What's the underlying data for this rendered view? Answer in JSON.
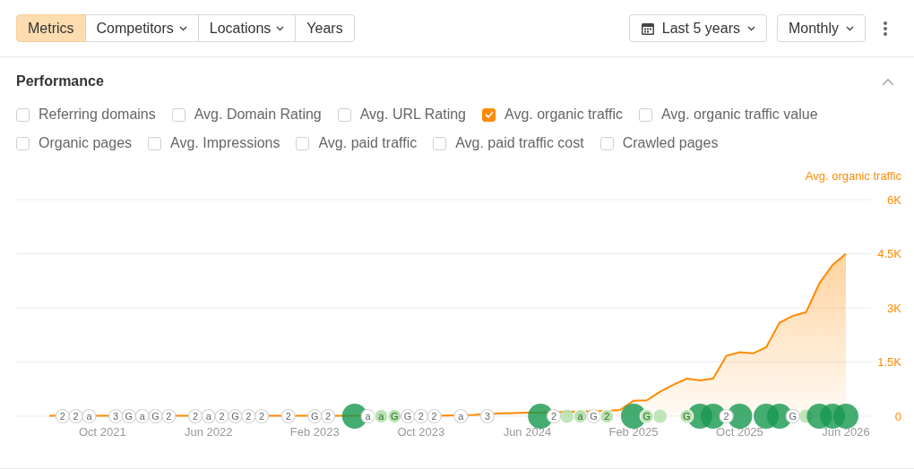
{
  "toolbar": {
    "segments": [
      {
        "label": "Metrics",
        "selected": true,
        "dropdown": false
      },
      {
        "label": "Competitors",
        "selected": false,
        "dropdown": true
      },
      {
        "label": "Locations",
        "selected": false,
        "dropdown": true
      },
      {
        "label": "Years",
        "selected": false,
        "dropdown": false
      }
    ],
    "period": {
      "label": "Last 5 years"
    },
    "interval": {
      "label": "Monthly"
    }
  },
  "performance": {
    "title": "Performance",
    "expanded": true,
    "metrics": [
      {
        "label": "Referring domains",
        "checked": false
      },
      {
        "label": "Avg. Domain Rating",
        "checked": false
      },
      {
        "label": "Avg. URL Rating",
        "checked": false
      },
      {
        "label": "Avg. organic traffic",
        "checked": true
      },
      {
        "label": "Avg. organic traffic value",
        "checked": false
      },
      {
        "label": "Organic pages",
        "checked": false
      },
      {
        "label": "Avg. Impressions",
        "checked": false
      },
      {
        "label": "Avg. paid traffic",
        "checked": false
      },
      {
        "label": "Avg. paid traffic cost",
        "checked": false
      },
      {
        "label": "Crawled pages",
        "checked": false
      }
    ],
    "chart_data": {
      "type": "area",
      "categories": [
        null,
        null,
        null,
        null,
        "Oct 2021",
        null,
        null,
        null,
        null,
        null,
        null,
        null,
        "Jun 2022",
        null,
        null,
        null,
        null,
        null,
        null,
        null,
        "Feb 2023",
        null,
        null,
        null,
        null,
        null,
        null,
        null,
        "Oct 2023",
        null,
        null,
        null,
        null,
        null,
        null,
        null,
        "Jun 2024",
        null,
        null,
        null,
        null,
        null,
        null,
        null,
        "Feb 2025",
        null,
        null,
        null,
        null,
        null,
        null,
        null,
        "Oct 2025",
        null,
        null,
        null,
        null,
        null,
        null,
        null,
        "Jun 2026"
      ],
      "series": [
        {
          "name": "Avg. organic traffic",
          "color": "#ff8a00",
          "values": [
            10,
            10,
            10,
            10,
            10,
            10,
            10,
            10,
            10,
            10,
            10,
            10,
            10,
            10,
            10,
            10,
            10,
            10,
            10,
            10,
            10,
            10,
            10,
            10,
            10,
            10,
            10,
            10,
            10,
            10,
            20,
            30,
            40,
            null,
            80,
            90,
            100,
            100,
            null,
            null,
            null,
            null,
            150,
            170,
            430,
            440,
            680,
            870,
            1040,
            990,
            1040,
            1670,
            1770,
            1740,
            1910,
            2590,
            2780,
            2880,
            3680,
            4190,
            4500
          ]
        }
      ],
      "ylim": [
        0,
        6000
      ],
      "grid": true,
      "yticks": [
        {
          "value": 0,
          "label": "0"
        },
        {
          "value": 1500,
          "label": "1.5K"
        },
        {
          "value": 3000,
          "label": "3K"
        },
        {
          "value": 4500,
          "label": "4.5K"
        },
        {
          "value": 6000,
          "label": "6K"
        }
      ]
    },
    "event_markers": [
      {
        "kind": "none"
      },
      {
        "kind": "badge",
        "label": "2"
      },
      {
        "kind": "badge",
        "label": "2"
      },
      {
        "kind": "badge",
        "label": "a"
      },
      {
        "kind": "none"
      },
      {
        "kind": "badge",
        "label": "3"
      },
      {
        "kind": "badge",
        "label": "G"
      },
      {
        "kind": "badge",
        "label": "a"
      },
      {
        "kind": "badge",
        "label": "G"
      },
      {
        "kind": "badge",
        "label": "2"
      },
      {
        "kind": "none"
      },
      {
        "kind": "badge",
        "label": "2"
      },
      {
        "kind": "badge",
        "label": "a"
      },
      {
        "kind": "badge",
        "label": "2"
      },
      {
        "kind": "badge",
        "label": "G"
      },
      {
        "kind": "badge",
        "label": "2"
      },
      {
        "kind": "badge",
        "label": "2"
      },
      {
        "kind": "none"
      },
      {
        "kind": "badge",
        "label": "2"
      },
      {
        "kind": "none"
      },
      {
        "kind": "badge",
        "label": "G"
      },
      {
        "kind": "badge",
        "label": "2"
      },
      {
        "kind": "none"
      },
      {
        "kind": "event"
      },
      {
        "kind": "badge",
        "label": "a"
      },
      {
        "kind": "faded",
        "label": "a"
      },
      {
        "kind": "faded",
        "label": "G"
      },
      {
        "kind": "badge",
        "label": "G"
      },
      {
        "kind": "badge",
        "label": "2"
      },
      {
        "kind": "badge",
        "label": "2"
      },
      {
        "kind": "none"
      },
      {
        "kind": "badge",
        "label": "a"
      },
      {
        "kind": "none"
      },
      {
        "kind": "badge",
        "label": "3"
      },
      {
        "kind": "none"
      },
      {
        "kind": "none"
      },
      {
        "kind": "none"
      },
      {
        "kind": "event"
      },
      {
        "kind": "badge",
        "label": "2"
      },
      {
        "kind": "faded"
      },
      {
        "kind": "faded",
        "label": "a"
      },
      {
        "kind": "badge",
        "label": "G"
      },
      {
        "kind": "faded",
        "label": "2"
      },
      {
        "kind": "none"
      },
      {
        "kind": "event"
      },
      {
        "kind": "faded",
        "label": "G"
      },
      {
        "kind": "faded"
      },
      {
        "kind": "none"
      },
      {
        "kind": "faded",
        "label": "G"
      },
      {
        "kind": "event"
      },
      {
        "kind": "event"
      },
      {
        "kind": "badge",
        "label": "2"
      },
      {
        "kind": "event"
      },
      {
        "kind": "none"
      },
      {
        "kind": "event"
      },
      {
        "kind": "event"
      },
      {
        "kind": "badge",
        "label": "G"
      },
      {
        "kind": "faded"
      },
      {
        "kind": "event"
      },
      {
        "kind": "event"
      },
      {
        "kind": "event"
      }
    ]
  }
}
